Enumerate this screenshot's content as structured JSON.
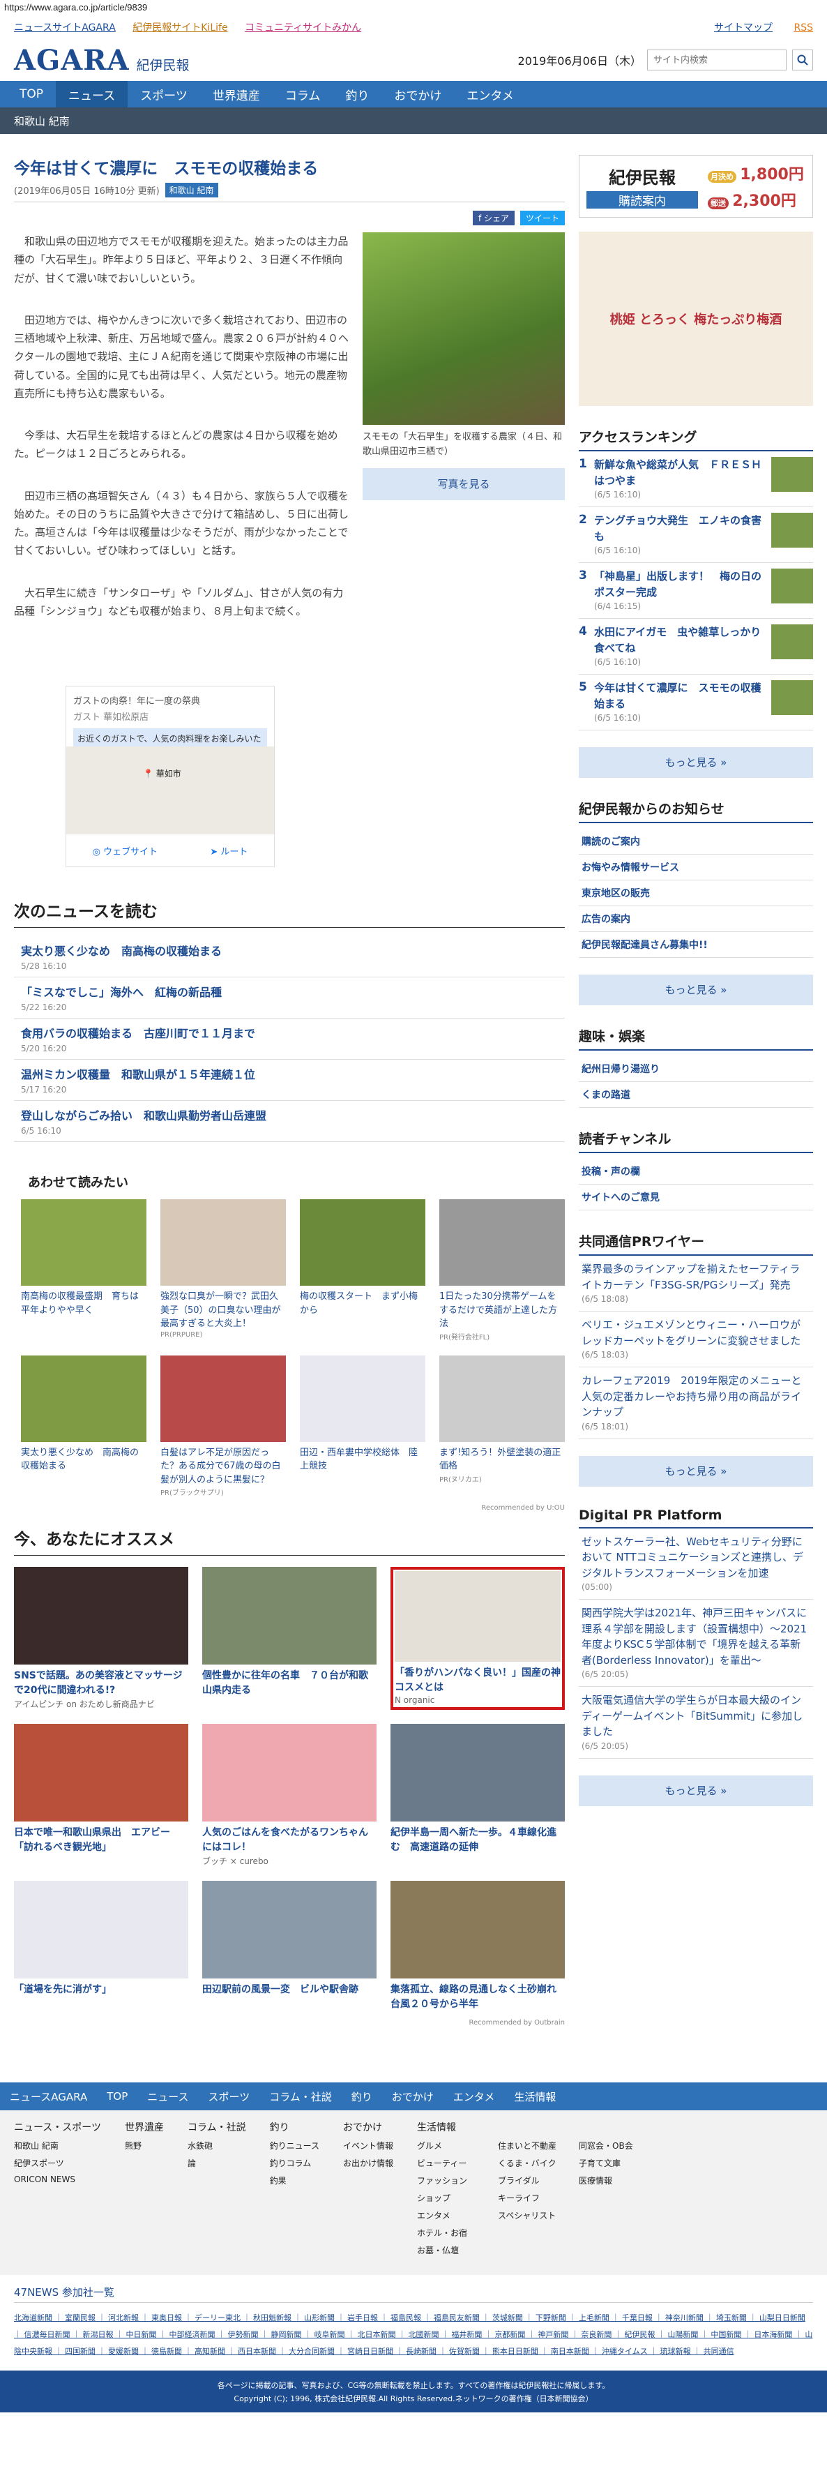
{
  "url": "https://www.agara.co.jp/article/9839",
  "toplinks": [
    "ニュースサイトAGARA",
    "紀伊民報サイトKiLife",
    "コミュニティサイトみかん"
  ],
  "topright": [
    "サイトマップ",
    "RSS"
  ],
  "logo": {
    "main": "AGARA",
    "sub": "紀伊民報"
  },
  "date": "2019年06月06日（木）",
  "search_placeholder": "サイト内検索",
  "gnav": [
    "TOP",
    "ニュース",
    "スポーツ",
    "世界遺産",
    "コラム",
    "釣り",
    "おでかけ",
    "エンタメ"
  ],
  "subnav": "和歌山 紀南",
  "article": {
    "title": "今年は甘くて濃厚に　スモモの収穫始まる",
    "meta": "(2019年06月05日 16時10分 更新)",
    "tag": "和歌山 紀南",
    "share": [
      "f シェア",
      "ツイート"
    ],
    "paragraphs": [
      "和歌山県の田辺地方でスモモが収穫期を迎えた。始まったのは主力品種の「大石早生」。昨年より５日ほど、平年より２、３日遅く不作傾向だが、甘くて濃い味でおいしいという。",
      "田辺地方では、梅やかんきつに次いで多く栽培されており、田辺市の三栖地域や上秋津、新庄、万呂地域で盛ん。農家２０６戸が計約４０ヘクタールの園地で栽培、主にＪＡ紀南を通じて関東や京阪神の市場に出荷している。全国的に見ても出荷は早く、人気だという。地元の農産物直売所にも持ち込む農家もいる。",
      "今季は、大石早生を栽培するほとんどの農家は４日から収穫を始めた。ピークは１２日ごろとみられる。",
      "田辺市三栖の髙垣智矢さん（４３）も４日から、家族ら５人で収穫を始めた。その日のうちに品質や大きさで分けて箱詰めし、５日に出荷した。髙垣さんは「今年は収穫量は少なそうだが、雨が少なかったことで甘くておいしい。ぜひ味わってほしい」と話す。",
      "大石早生に続き「サンタローザ」や「ソルダム」、甘さが人気の有力品種「シンジョウ」なども収穫が始まり、８月上旬まで続く。"
    ],
    "caption": "スモモの「大石早生」を収穫する農家（４日、和歌山県田辺市三栖で）",
    "photo_btn": "写真を見る"
  },
  "map": {
    "top": "ガストの肉祭！年に一度の祭典",
    "name": "ガスト 華如松原店",
    "desc": "お近くのガストで、人気の肉料理をお楽しみいただけます！",
    "pin": "華如市",
    "btns": [
      "ウェブサイト",
      "ルート"
    ]
  },
  "next_news": {
    "heading": "次のニュースを読む",
    "items": [
      {
        "t": "実太り悪く少なめ　南高梅の収穫始まる",
        "d": "5/28 16:10"
      },
      {
        "t": "「ミスなでしこ」海外へ　紅梅の新品種",
        "d": "5/22 16:20"
      },
      {
        "t": "食用バラの収穫始まる　古座川町で１１月まで",
        "d": "5/20 16:20"
      },
      {
        "t": "温州ミカン収穫量　和歌山県が１５年連続１位",
        "d": "5/17 16:20"
      },
      {
        "t": "登山しながらごみ拾い　和歌山県勤労者山岳連盟",
        "d": "6/5 16:10"
      }
    ]
  },
  "related": {
    "heading": "あわせて読みたい",
    "items": [
      {
        "c": "南高梅の収穫最盛期　育ちは平年よりやや早く",
        "s": ""
      },
      {
        "c": "強烈な口臭が一瞬で？武田久美子（50）の口臭ない理由が最高すぎると大炎上！",
        "s": "PR(PRPURE)"
      },
      {
        "c": "梅の収穫スタート　まず小梅から",
        "s": ""
      },
      {
        "c": "1日たった30分携帯ゲームをするだけで英語が上達した方法",
        "s": "PR(発行会社FL)"
      },
      {
        "c": "実太り悪く少なめ　南高梅の収穫始まる",
        "s": ""
      },
      {
        "c": "白髪はアレ不足が原因だった？ある成分で67歳の母の白髪が別人のように黒髪に？",
        "s": "PR(ブラックサプリ)"
      },
      {
        "c": "田辺・西牟婁中学校総体　陸上競技",
        "s": ""
      },
      {
        "c": "まず!知ろう！外壁塗装の適正価格",
        "s": "PR(ヌリカエ)"
      }
    ],
    "rec": "Recommended by U:OU"
  },
  "osusume": {
    "heading": "今、あなたにオススメ",
    "items": [
      {
        "c": "SNSで話題。あの美容液とマッサージで20代に間違われる!?",
        "s": "アイムピンチ on おためし新商品ナビ"
      },
      {
        "c": "個性豊かに往年の名車　７０台が和歌山県内走る",
        "s": ""
      },
      {
        "c": "「香りがハンパなく良い！」国産の神コスメとは",
        "s": "N organic"
      },
      {
        "c": "日本で唯一和歌山県県出　エアビー「訪れるべき観光地」",
        "s": ""
      },
      {
        "c": "人気のごはんを食べたがるワンちゃんにはコレ！",
        "s": "ブッチ × curebo"
      },
      {
        "c": "紀伊半島一周へ新た一歩。４車線化進む　高速道路の延伸",
        "s": ""
      },
      {
        "c": "「道場を先に消がす」",
        "s": ""
      },
      {
        "c": "田辺駅前の風景一変　ビルや駅舎跡",
        "s": ""
      },
      {
        "c": "集落孤立、線路の見通しなく土砂崩れ　台風２０号から半年",
        "s": ""
      }
    ],
    "rec": "Recommended by Outbrain"
  },
  "side": {
    "ad": {
      "name": "紀伊民報",
      "kb": "購読案内",
      "l1": "月決め",
      "p1": "1,800円",
      "l2": "郵送",
      "p2": "2,300円"
    },
    "ad2": "桃姫 とろっく 梅たっぷり梅酒",
    "ranking_title": "アクセスランキング",
    "ranking": [
      {
        "t": "新鮮な魚や総菜が人気　ＦＲＥＳＨはつやま",
        "d": "(6/5 16:10)"
      },
      {
        "t": "テングチョウ大発生　エノキの食害も",
        "d": "(6/5 16:10)"
      },
      {
        "t": "「神島星」出版します！　梅の日のポスター完成",
        "d": "(6/4 16:15)"
      },
      {
        "t": "水田にアイガモ　虫や雑草しっかり食べてね",
        "d": "(6/5 16:10)"
      },
      {
        "t": "今年は甘くて濃厚に　スモモの収穫始まる",
        "d": "(6/5 16:10)"
      }
    ],
    "more": "もっと見る »",
    "notice_title": "紀伊民報からのお知らせ",
    "notice": [
      "購読のご案内",
      "お悔やみ情報サービス",
      "東京地区の販売",
      "広告の案内",
      "紀伊民報配達員さん募集中!!"
    ],
    "hobby_title": "趣味・娯楽",
    "hobby": [
      "紀州日帰り湯巡り",
      "くまの路道"
    ],
    "reader_title": "読者チャンネル",
    "reader": [
      "投稿・声の欄",
      "サイトへのご意見"
    ],
    "wire_title": "共同通信PRワイヤー",
    "wire": [
      {
        "t": "業界最多のラインアップを揃えたセーフティライトカーテン「F3SG-SR/PGシリーズ」発売",
        "d": "(6/5 18:08)"
      },
      {
        "t": "ベリエ・ジュエメゾンとウィニー・ハーロウがレッドカーペットをグリーンに変貌させました",
        "d": "(6/5 18:03)"
      },
      {
        "t": "カレーフェア2019　2019年限定のメニューと人気の定番カレーやお持ち帰り用の商品がラインナップ",
        "d": "(6/5 18:01)"
      }
    ],
    "dpr_title": "Digital PR Platform",
    "dpr": [
      {
        "t": "ゼットスケーラー社、Webセキュリティ分野において NTTコミュニケーションズと連携し、デジタルトランスフォーメーションを加速",
        "d": "(05:00)"
      },
      {
        "t": "関西学院大学は2021年、神戸三田キャンパスに理系４学部を開設します（設置構想中）～2021年度よりKSC５学部体制で「境界を越える革新者(Borderless Innovator)」を輩出～",
        "d": "(6/5 20:05)"
      },
      {
        "t": "大阪電気通信大学の学生らが日本最大級のインディーゲームイベント「BitSummit」に参加しました",
        "d": "(6/5 20:05)"
      }
    ]
  },
  "footer": {
    "nav": [
      "ニュースAGARA",
      "TOP",
      "ニュース",
      "スポーツ",
      "コラム・社説",
      "釣り",
      "おでかけ",
      "エンタメ",
      "生活情報"
    ],
    "cols": [
      {
        "h": "ニュース・スポーツ",
        "items": [
          "和歌山 紀南",
          "紀伊スポーツ",
          "ORICON NEWS"
        ]
      },
      {
        "h": "世界遺産",
        "items": [
          "熊野"
        ]
      },
      {
        "h": "コラム・社説",
        "items": [
          "水鉄砲",
          "論"
        ]
      },
      {
        "h": "釣り",
        "items": [
          "釣りニュース",
          "釣りコラム",
          "釣果"
        ]
      },
      {
        "h": "おでかけ",
        "items": [
          "イベント情報",
          "お出かけ情報"
        ]
      }
    ],
    "life_h": "生活情報",
    "life": [
      "グルメ",
      "住まいと不動産",
      "同窓会・OB会",
      "ビューティー",
      "くるま・バイク",
      "子育て文庫",
      "ファッション",
      "ブライダル",
      "医療情報",
      "ショップ",
      "キーライフ",
      "",
      "エンタメ",
      "スペシャリスト",
      "",
      "ホテル・お宿",
      "",
      "",
      "お墓・仏壇",
      "",
      ""
    ],
    "n47": "47NEWS 参加社一覧",
    "n47_list": "北海道新聞 ｜ 室蘭民報 ｜ 河北新報 ｜ 東奥日報 ｜ デーリー東北 ｜ 秋田魁新報 ｜ 山形新聞 ｜ 岩手日報 ｜ 福島民報 ｜ 福島民友新聞 ｜ 茨城新聞 ｜ 下野新聞 ｜ 上毛新聞 ｜ 千葉日報 ｜ 神奈川新聞 ｜ 埼玉新聞 ｜ 山梨日日新聞 ｜ 信濃毎日新聞 ｜ 新潟日報 ｜ 中日新聞 ｜ 中部経済新聞 ｜ 伊勢新聞 ｜ 静岡新聞 ｜ 岐阜新聞 ｜ 北日本新聞 ｜ 北國新聞 ｜ 福井新聞 ｜ 京都新聞 ｜ 神戸新聞 ｜ 奈良新聞 ｜ 紀伊民報 ｜ 山陽新聞 ｜ 中国新聞 ｜ 日本海新聞 ｜ 山陰中央新報 ｜ 四国新聞 ｜ 愛媛新聞 ｜ 徳島新聞 ｜ 高知新聞 ｜ 西日本新聞 ｜ 大分合同新聞 ｜ 宮崎日日新聞 ｜ 長崎新聞 ｜ 佐賀新聞 ｜ 熊本日日新聞 ｜ 南日本新聞 ｜ 沖縄タイムス ｜ 琉球新報 ｜ 共同通信",
    "copy1": "各ページに掲載の記事、写真および、CG等の無断転載を禁止します。すべての著作権は紀伊民報社に帰属します。",
    "copy2": "Copyright (C); 1996, 株式会社紀伊民報.All Rights Reserved.ネットワークの著作権（日本新聞協会）"
  }
}
